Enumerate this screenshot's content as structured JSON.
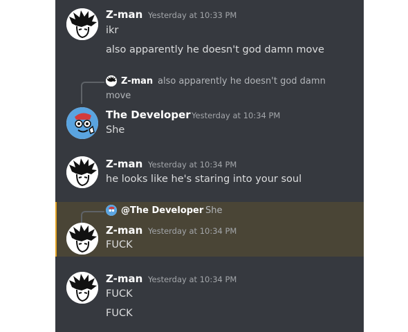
{
  "messages": [
    {
      "author": "Z-man",
      "timestamp": "Yesterday at 10:33 PM",
      "lines": [
        "ikr",
        "also apparently he doesn't god damn move"
      ]
    },
    {
      "reply": {
        "author": "Z-man",
        "text_line1": "also apparently he doesn't god damn",
        "text_line2": "move"
      },
      "author": "The Developer",
      "timestamp": "Yesterday at 10:34 PM",
      "lines": [
        "She"
      ]
    },
    {
      "author": "Z-man",
      "timestamp": "Yesterday at 10:34 PM",
      "lines": [
        "he looks like he's staring into your soul"
      ]
    },
    {
      "reply": {
        "author": "@The Developer",
        "text": "She"
      },
      "author": "Z-man",
      "timestamp": "Yesterday at 10:34 PM",
      "lines": [
        "FUCK"
      ],
      "highlighted": true
    },
    {
      "author": "Z-man",
      "timestamp": "Yesterday at 10:34 PM",
      "lines": [
        "FUCK",
        "FUCK"
      ]
    }
  ],
  "colors": {
    "chat_background": "#36393f",
    "highlight_background": "#4a4536",
    "highlight_border": "#e4a323",
    "author_name": "#ffffff",
    "timestamp": "#a3a6aa",
    "message_text": "#dcddde"
  },
  "icons": {
    "zman_avatar": "spiky-hair-avatar-icon",
    "developer_avatar": "blue-creature-avatar-icon"
  }
}
